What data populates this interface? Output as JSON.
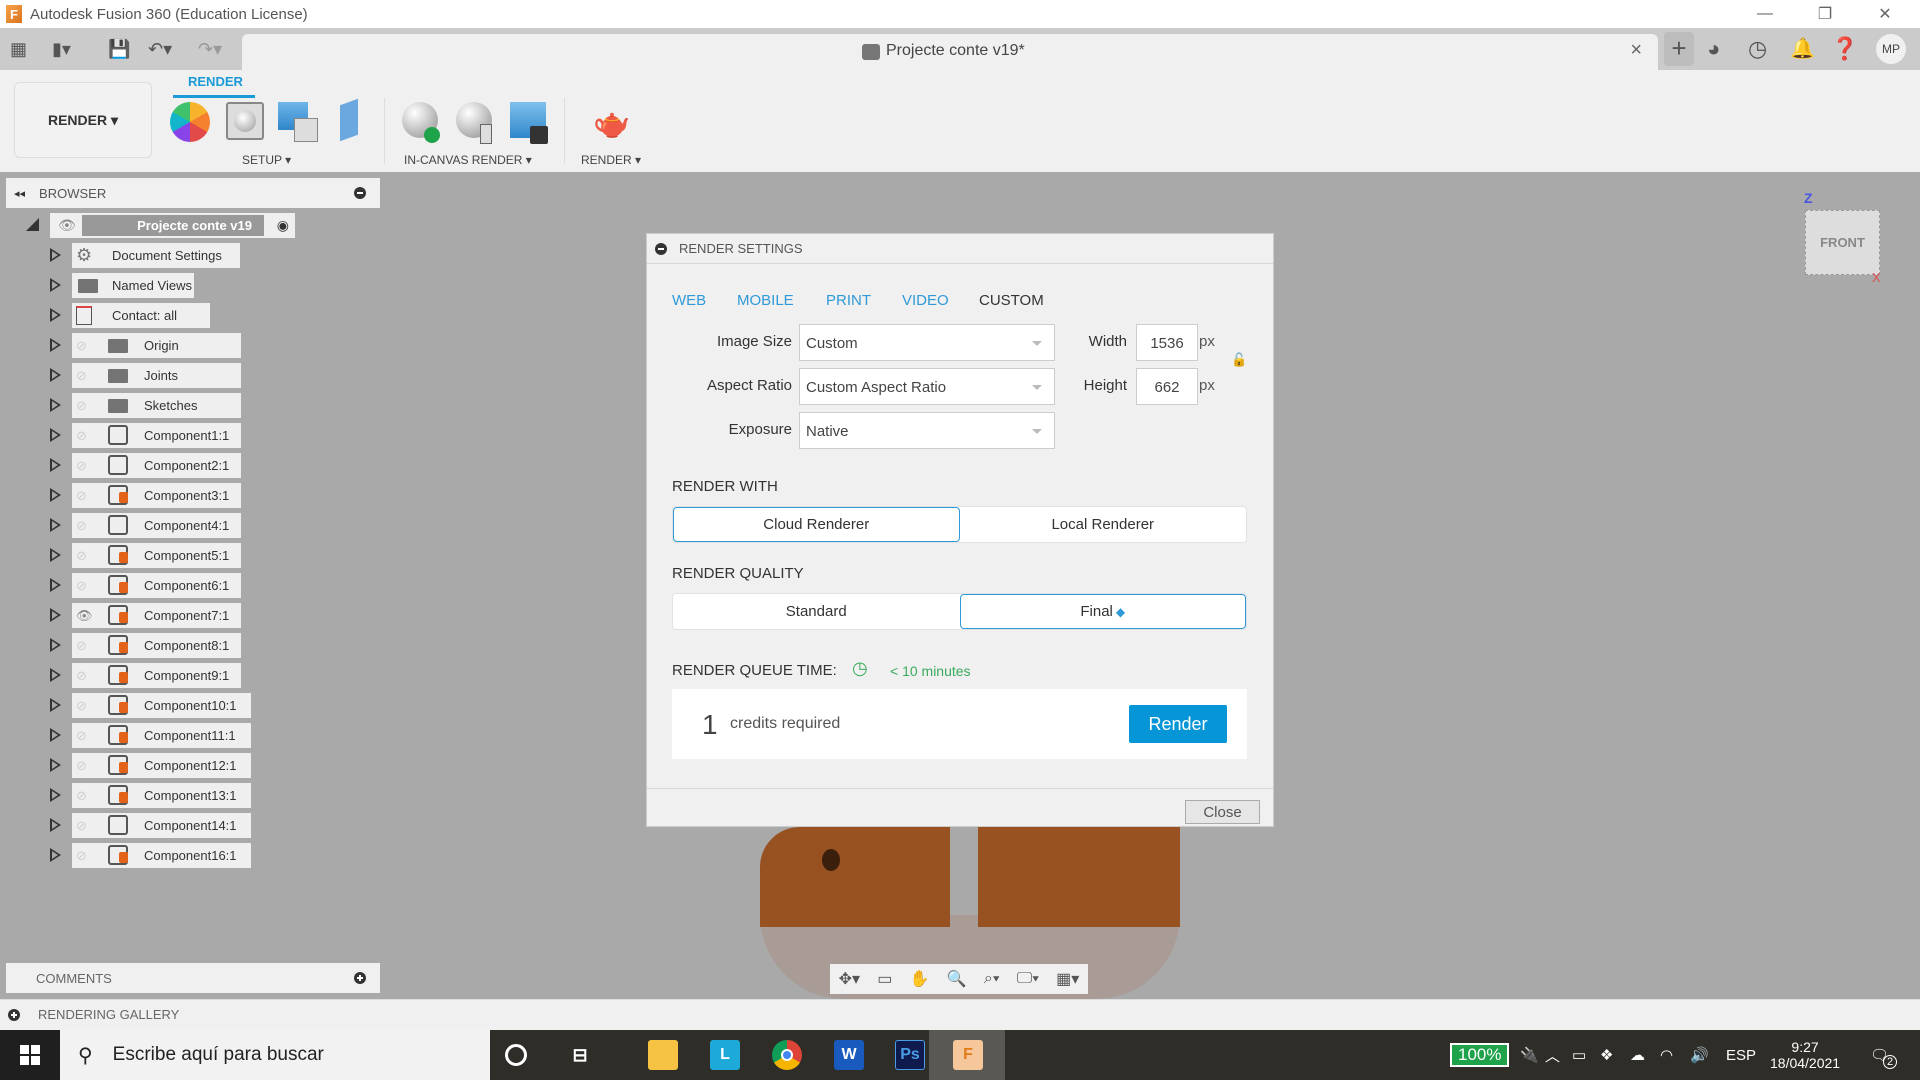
{
  "window": {
    "app_icon": "fusion-360-icon",
    "title": "Autodesk Fusion 360 (Education License)",
    "controls": [
      "minimize",
      "restore",
      "close"
    ]
  },
  "quick_access": {
    "icons": [
      "grid-icon",
      "file-icon",
      "save-icon",
      "undo-icon",
      "redo-icon"
    ]
  },
  "document_tab": {
    "name": "Projecte conte v19*",
    "close": "×"
  },
  "header_right": {
    "icons": [
      "add-tab-icon",
      "extensions-icon",
      "job-status-icon",
      "notifications-icon",
      "help-icon"
    ],
    "avatar": "MP"
  },
  "ribbon": {
    "workspace_button": "RENDER ▾",
    "active_tab": "RENDER",
    "groups": [
      {
        "label": "SETUP ▾",
        "tools": [
          "appearance",
          "scene-settings",
          "texture-map-controls",
          "decal"
        ]
      },
      {
        "label": "IN-CANVAS RENDER ▾",
        "tools": [
          "in-canvas-render",
          "in-canvas-render-settings",
          "capture-image"
        ]
      },
      {
        "label": "RENDER ▾",
        "tools": [
          "render"
        ]
      }
    ]
  },
  "browser": {
    "title": "BROWSER",
    "root": "Projecte conte v19",
    "items": [
      {
        "label": "Document Settings",
        "icon": "gear-icon",
        "eye": false
      },
      {
        "label": "Named Views",
        "icon": "folder-icon",
        "eye": false
      },
      {
        "label": "Contact: all",
        "icon": "contact-icon",
        "eye": false
      },
      {
        "label": "Origin",
        "icon": "folder-icon",
        "eye": "hidden"
      },
      {
        "label": "Joints",
        "icon": "folder-icon",
        "eye": "hidden"
      },
      {
        "label": "Sketches",
        "icon": "folder-icon",
        "eye": "hidden"
      },
      {
        "label": "Component1:1",
        "icon": "component-icon",
        "eye": "hidden"
      },
      {
        "label": "Component2:1",
        "icon": "component-icon",
        "eye": "hidden"
      },
      {
        "label": "Component3:1",
        "icon": "component-pinned-icon",
        "eye": "hidden"
      },
      {
        "label": "Component4:1",
        "icon": "component-icon",
        "eye": "hidden"
      },
      {
        "label": "Component5:1",
        "icon": "component-pinned-icon",
        "eye": "hidden"
      },
      {
        "label": "Component6:1",
        "icon": "component-pinned-icon",
        "eye": "hidden"
      },
      {
        "label": "Component7:1",
        "icon": "component-pinned-icon",
        "eye": "visible"
      },
      {
        "label": "Component8:1",
        "icon": "component-pinned-icon",
        "eye": "hidden"
      },
      {
        "label": "Component9:1",
        "icon": "component-pinned-icon",
        "eye": "hidden"
      },
      {
        "label": "Component10:1",
        "icon": "component-pinned-icon",
        "eye": "hidden"
      },
      {
        "label": "Component11:1",
        "icon": "component-pinned-icon",
        "eye": "hidden"
      },
      {
        "label": "Component12:1",
        "icon": "component-pinned-icon",
        "eye": "hidden"
      },
      {
        "label": "Component13:1",
        "icon": "component-pinned-icon",
        "eye": "hidden"
      },
      {
        "label": "Component14:1",
        "icon": "component-icon",
        "eye": "hidden"
      },
      {
        "label": "Component16:1",
        "icon": "component-pinned-icon",
        "eye": "hidden"
      }
    ]
  },
  "viewcube": {
    "face": "FRONT",
    "axis_z": "Z",
    "axis_x": "X"
  },
  "render_dialog": {
    "title": "RENDER SETTINGS",
    "presets": [
      "WEB",
      "MOBILE",
      "PRINT",
      "VIDEO",
      "CUSTOM"
    ],
    "active_preset": "CUSTOM",
    "image_size_label": "Image Size",
    "image_size_value": "Custom",
    "aspect_ratio_label": "Aspect Ratio",
    "aspect_ratio_value": "Custom Aspect Ratio",
    "exposure_label": "Exposure",
    "exposure_value": "Native",
    "width_label": "Width",
    "width_value": "1536",
    "height_label": "Height",
    "height_value": "662",
    "unit": "px",
    "render_with_label": "RENDER WITH",
    "render_with_options": [
      "Cloud Renderer",
      "Local Renderer"
    ],
    "render_with_selected": "Cloud Renderer",
    "quality_label": "RENDER QUALITY",
    "quality_options": [
      "Standard",
      "Final"
    ],
    "quality_selected": "Final",
    "queue_label": "RENDER QUEUE TIME:",
    "queue_value": "< 10 minutes",
    "credits_number": "1",
    "credits_text": "credits required",
    "render_button": "Render",
    "close_button": "Close",
    "accent_color": "#0696d7",
    "queue_color": "#3aaa5c"
  },
  "panels": {
    "comments": "COMMENTS",
    "rendering_gallery": "RENDERING GALLERY"
  },
  "navbar": {
    "icons": [
      "orbit-icon",
      "look-at-icon",
      "pan-icon",
      "zoom-icon",
      "fit-icon",
      "display-settings-icon",
      "grid-settings-icon"
    ]
  },
  "taskbar": {
    "search_placeholder": "Escribe aquí para buscar",
    "apps": [
      "cortana",
      "task-view",
      "file-explorer",
      "L",
      "chrome",
      "word",
      "photoshop",
      "fusion-360"
    ],
    "battery": "100%",
    "language": "ESP",
    "time": "9:27",
    "date": "18/04/2021",
    "notifications_count": "2"
  }
}
